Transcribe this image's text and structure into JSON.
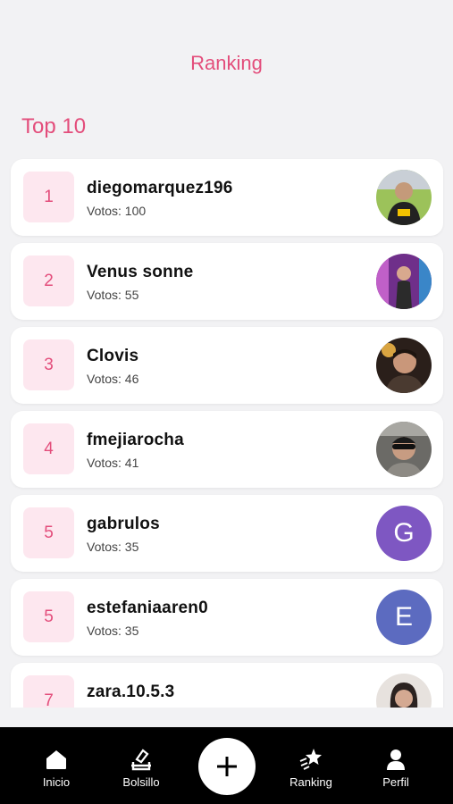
{
  "header": {
    "title": "Ranking"
  },
  "section": {
    "title": "Top 10"
  },
  "ranking": [
    {
      "rank": "1",
      "name": "diegomarquez196",
      "votes": "Votos: 100",
      "avatar": {
        "type": "photo",
        "icon": "photo-avatar-icon",
        "color": "#7ea64a"
      }
    },
    {
      "rank": "2",
      "name": "Venus sonne",
      "votes": "Votos: 55",
      "avatar": {
        "type": "photo",
        "icon": "photo-avatar-icon",
        "color": "#8e3c9a"
      }
    },
    {
      "rank": "3",
      "name": "Clovis",
      "votes": "Votos: 46",
      "avatar": {
        "type": "photo",
        "icon": "photo-avatar-icon",
        "color": "#5a4a3c"
      }
    },
    {
      "rank": "4",
      "name": "fmejiarocha",
      "votes": "Votos: 41",
      "avatar": {
        "type": "photo",
        "icon": "photo-avatar-icon",
        "color": "#8b8a84"
      }
    },
    {
      "rank": "5",
      "name": "gabrulos",
      "votes": "Votos: 35",
      "avatar": {
        "type": "letter",
        "letter": "G",
        "color": "#7e57c2"
      }
    },
    {
      "rank": "5",
      "name": "estefaniaaren0",
      "votes": "Votos: 35",
      "avatar": {
        "type": "letter",
        "letter": "E",
        "color": "#5c6bc0"
      }
    },
    {
      "rank": "7",
      "name": "zara.10.5.3",
      "votes": "",
      "avatar": {
        "type": "photo",
        "icon": "photo-avatar-icon",
        "color": "#b8a59a"
      }
    }
  ],
  "tabbar": {
    "items": [
      {
        "label": "Inicio",
        "icon": "home-icon"
      },
      {
        "label": "Bolsillo",
        "icon": "vote-box-icon"
      },
      {
        "label": "",
        "icon": "plus-icon"
      },
      {
        "label": "Ranking",
        "icon": "star-ranking-icon"
      },
      {
        "label": "Perfil",
        "icon": "user-icon"
      }
    ]
  },
  "colors": {
    "accent": "#e34d7b",
    "rank_bg": "#fde7ef",
    "background": "#f2f2f4",
    "tabbar": "#000000"
  }
}
